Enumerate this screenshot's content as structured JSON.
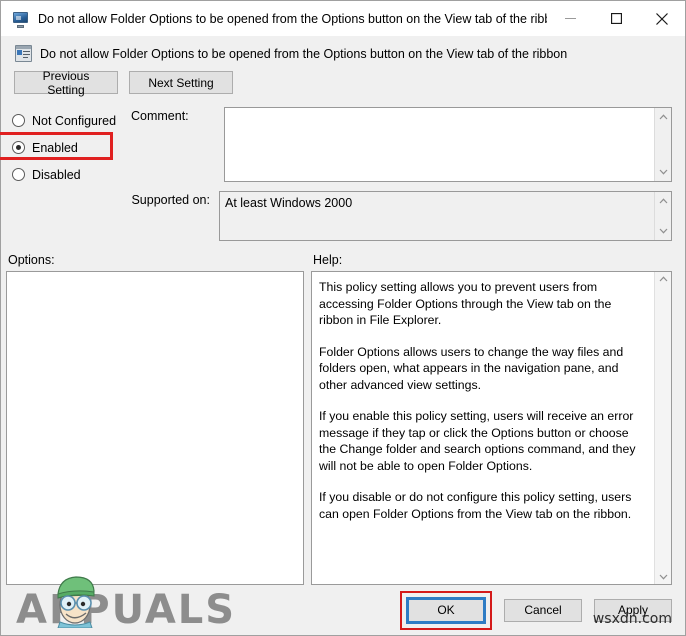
{
  "window": {
    "title": "Do not allow Folder Options to be opened from the Options button on the View tab of the ribbon",
    "icon": "computer-monitor-icon",
    "controls": {
      "minimize": "minimize-icon",
      "maximize": "maximize-icon",
      "close": "close-icon"
    }
  },
  "policy": {
    "icon": "group-policy-setting-icon",
    "title": "Do not allow Folder Options to be opened from the Options button on the View tab of the ribbon"
  },
  "nav": {
    "previous_label": "Previous Setting",
    "next_label": "Next Setting"
  },
  "state_options": {
    "items": [
      {
        "label": "Not Configured",
        "selected": false
      },
      {
        "label": "Enabled",
        "selected": true
      },
      {
        "label": "Disabled",
        "selected": false
      }
    ],
    "selected_value": "Enabled",
    "highlight_color": "#e02020"
  },
  "comment": {
    "label": "Comment:",
    "value": "",
    "placeholder": ""
  },
  "supported_on": {
    "label": "Supported on:",
    "value": "At least Windows 2000"
  },
  "options_pane": {
    "label": "Options:",
    "content": ""
  },
  "help_pane": {
    "label": "Help:",
    "paragraphs": [
      "This policy setting allows you to prevent users from accessing Folder Options through the View tab on the ribbon in File Explorer.",
      "Folder Options allows users to change the way files and folders open, what appears in the navigation pane, and other advanced view settings.",
      "If you enable this policy setting, users will receive an error message if they tap or click the Options button or choose the Change folder and search options command, and they will not be able to open Folder Options.",
      "If you disable or do not configure this policy setting, users can open Folder Options from the View tab on the ribbon."
    ]
  },
  "footer": {
    "ok_label": "OK",
    "cancel_label": "Cancel",
    "apply_label": "Apply",
    "ok_focus_color": "#2e7cc4",
    "ok_highlight_color": "#d41a1a"
  },
  "watermarks": {
    "brand_text": "APPUALS",
    "brand_color": "#8d8d8d",
    "site_text": "wsxdn.com"
  }
}
